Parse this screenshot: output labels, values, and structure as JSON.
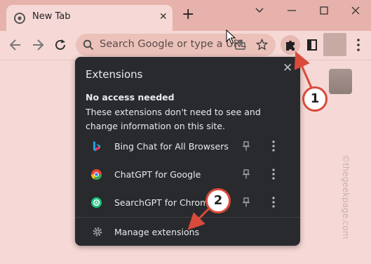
{
  "tab": {
    "title": "New Tab",
    "close_glyph": "✕",
    "new_tab_glyph": "+"
  },
  "omnibox": {
    "text": "Search Google or type a URL"
  },
  "popup": {
    "title": "Extensions",
    "close_glyph": "✕",
    "section_heading": "No access needed",
    "section_description": "These extensions don't need to see and change information on this site.",
    "extensions": [
      {
        "name": "Bing Chat for All Browsers",
        "icon": "bing-icon"
      },
      {
        "name": "ChatGPT for Google",
        "icon": "chatgpt-for-google-icon"
      },
      {
        "name": "SearchGPT for Chrome",
        "icon": "searchgpt-icon"
      }
    ],
    "manage_label": "Manage extensions"
  },
  "callouts": {
    "first": "1",
    "second": "2"
  },
  "watermark": "©thegeekpage.com",
  "colors": {
    "titlebar": "#e7b2ab",
    "toolbar": "#f6d9d6",
    "popup": "#292a2d",
    "callout_border": "#d94a3a"
  }
}
